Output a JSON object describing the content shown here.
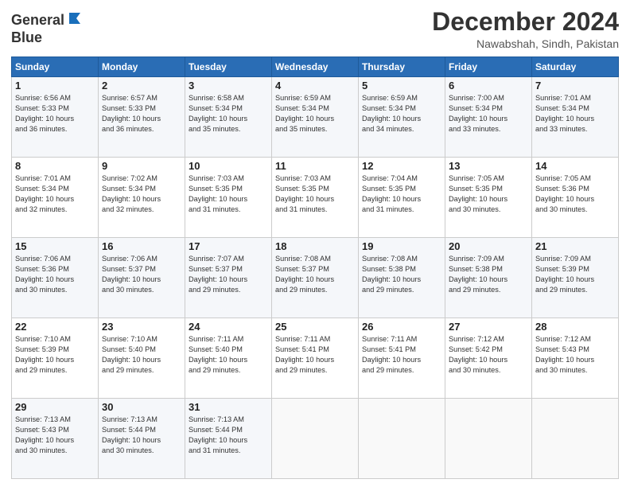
{
  "logo": {
    "line1": "General",
    "line2": "Blue"
  },
  "title": {
    "month": "December 2024",
    "location": "Nawabshah, Sindh, Pakistan"
  },
  "days_header": [
    "Sunday",
    "Monday",
    "Tuesday",
    "Wednesday",
    "Thursday",
    "Friday",
    "Saturday"
  ],
  "weeks": [
    [
      {
        "day": "1",
        "lines": [
          "Sunrise: 6:56 AM",
          "Sunset: 5:33 PM",
          "Daylight: 10 hours",
          "and 36 minutes."
        ]
      },
      {
        "day": "2",
        "lines": [
          "Sunrise: 6:57 AM",
          "Sunset: 5:33 PM",
          "Daylight: 10 hours",
          "and 36 minutes."
        ]
      },
      {
        "day": "3",
        "lines": [
          "Sunrise: 6:58 AM",
          "Sunset: 5:34 PM",
          "Daylight: 10 hours",
          "and 35 minutes."
        ]
      },
      {
        "day": "4",
        "lines": [
          "Sunrise: 6:59 AM",
          "Sunset: 5:34 PM",
          "Daylight: 10 hours",
          "and 35 minutes."
        ]
      },
      {
        "day": "5",
        "lines": [
          "Sunrise: 6:59 AM",
          "Sunset: 5:34 PM",
          "Daylight: 10 hours",
          "and 34 minutes."
        ]
      },
      {
        "day": "6",
        "lines": [
          "Sunrise: 7:00 AM",
          "Sunset: 5:34 PM",
          "Daylight: 10 hours",
          "and 33 minutes."
        ]
      },
      {
        "day": "7",
        "lines": [
          "Sunrise: 7:01 AM",
          "Sunset: 5:34 PM",
          "Daylight: 10 hours",
          "and 33 minutes."
        ]
      }
    ],
    [
      {
        "day": "8",
        "lines": [
          "Sunrise: 7:01 AM",
          "Sunset: 5:34 PM",
          "Daylight: 10 hours",
          "and 32 minutes."
        ]
      },
      {
        "day": "9",
        "lines": [
          "Sunrise: 7:02 AM",
          "Sunset: 5:34 PM",
          "Daylight: 10 hours",
          "and 32 minutes."
        ]
      },
      {
        "day": "10",
        "lines": [
          "Sunrise: 7:03 AM",
          "Sunset: 5:35 PM",
          "Daylight: 10 hours",
          "and 31 minutes."
        ]
      },
      {
        "day": "11",
        "lines": [
          "Sunrise: 7:03 AM",
          "Sunset: 5:35 PM",
          "Daylight: 10 hours",
          "and 31 minutes."
        ]
      },
      {
        "day": "12",
        "lines": [
          "Sunrise: 7:04 AM",
          "Sunset: 5:35 PM",
          "Daylight: 10 hours",
          "and 31 minutes."
        ]
      },
      {
        "day": "13",
        "lines": [
          "Sunrise: 7:05 AM",
          "Sunset: 5:35 PM",
          "Daylight: 10 hours",
          "and 30 minutes."
        ]
      },
      {
        "day": "14",
        "lines": [
          "Sunrise: 7:05 AM",
          "Sunset: 5:36 PM",
          "Daylight: 10 hours",
          "and 30 minutes."
        ]
      }
    ],
    [
      {
        "day": "15",
        "lines": [
          "Sunrise: 7:06 AM",
          "Sunset: 5:36 PM",
          "Daylight: 10 hours",
          "and 30 minutes."
        ]
      },
      {
        "day": "16",
        "lines": [
          "Sunrise: 7:06 AM",
          "Sunset: 5:37 PM",
          "Daylight: 10 hours",
          "and 30 minutes."
        ]
      },
      {
        "day": "17",
        "lines": [
          "Sunrise: 7:07 AM",
          "Sunset: 5:37 PM",
          "Daylight: 10 hours",
          "and 29 minutes."
        ]
      },
      {
        "day": "18",
        "lines": [
          "Sunrise: 7:08 AM",
          "Sunset: 5:37 PM",
          "Daylight: 10 hours",
          "and 29 minutes."
        ]
      },
      {
        "day": "19",
        "lines": [
          "Sunrise: 7:08 AM",
          "Sunset: 5:38 PM",
          "Daylight: 10 hours",
          "and 29 minutes."
        ]
      },
      {
        "day": "20",
        "lines": [
          "Sunrise: 7:09 AM",
          "Sunset: 5:38 PM",
          "Daylight: 10 hours",
          "and 29 minutes."
        ]
      },
      {
        "day": "21",
        "lines": [
          "Sunrise: 7:09 AM",
          "Sunset: 5:39 PM",
          "Daylight: 10 hours",
          "and 29 minutes."
        ]
      }
    ],
    [
      {
        "day": "22",
        "lines": [
          "Sunrise: 7:10 AM",
          "Sunset: 5:39 PM",
          "Daylight: 10 hours",
          "and 29 minutes."
        ]
      },
      {
        "day": "23",
        "lines": [
          "Sunrise: 7:10 AM",
          "Sunset: 5:40 PM",
          "Daylight: 10 hours",
          "and 29 minutes."
        ]
      },
      {
        "day": "24",
        "lines": [
          "Sunrise: 7:11 AM",
          "Sunset: 5:40 PM",
          "Daylight: 10 hours",
          "and 29 minutes."
        ]
      },
      {
        "day": "25",
        "lines": [
          "Sunrise: 7:11 AM",
          "Sunset: 5:41 PM",
          "Daylight: 10 hours",
          "and 29 minutes."
        ]
      },
      {
        "day": "26",
        "lines": [
          "Sunrise: 7:11 AM",
          "Sunset: 5:41 PM",
          "Daylight: 10 hours",
          "and 29 minutes."
        ]
      },
      {
        "day": "27",
        "lines": [
          "Sunrise: 7:12 AM",
          "Sunset: 5:42 PM",
          "Daylight: 10 hours",
          "and 30 minutes."
        ]
      },
      {
        "day": "28",
        "lines": [
          "Sunrise: 7:12 AM",
          "Sunset: 5:43 PM",
          "Daylight: 10 hours",
          "and 30 minutes."
        ]
      }
    ],
    [
      {
        "day": "29",
        "lines": [
          "Sunrise: 7:13 AM",
          "Sunset: 5:43 PM",
          "Daylight: 10 hours",
          "and 30 minutes."
        ]
      },
      {
        "day": "30",
        "lines": [
          "Sunrise: 7:13 AM",
          "Sunset: 5:44 PM",
          "Daylight: 10 hours",
          "and 30 minutes."
        ]
      },
      {
        "day": "31",
        "lines": [
          "Sunrise: 7:13 AM",
          "Sunset: 5:44 PM",
          "Daylight: 10 hours",
          "and 31 minutes."
        ]
      },
      {
        "day": "",
        "lines": []
      },
      {
        "day": "",
        "lines": []
      },
      {
        "day": "",
        "lines": []
      },
      {
        "day": "",
        "lines": []
      }
    ]
  ]
}
